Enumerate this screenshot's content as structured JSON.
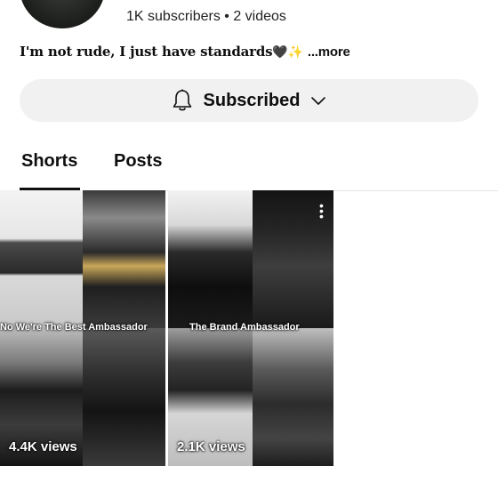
{
  "channel": {
    "stats": "1K subscribers • 2 videos",
    "bio_text": "I'm not rude, I just have standards",
    "bio_emoji_heart": "🖤",
    "bio_emoji_spark": "✨",
    "bio_more": "...more"
  },
  "subscribe": {
    "label": "Subscribed",
    "bell_icon": "bell-icon",
    "chevron_icon": "chevron-down-icon"
  },
  "tabs": [
    {
      "label": "Shorts",
      "active": true
    },
    {
      "label": "Posts",
      "active": false
    }
  ],
  "shorts": [
    {
      "caption": "No We're The Best Ambassador",
      "views": "4.4K views"
    },
    {
      "caption": "The Brand Ambassador",
      "views": "2.1K views"
    }
  ],
  "colors": {
    "button_bg": "#f1f1f1",
    "text": "#0f0f0f",
    "tab_underline": "#0f0f0f"
  }
}
